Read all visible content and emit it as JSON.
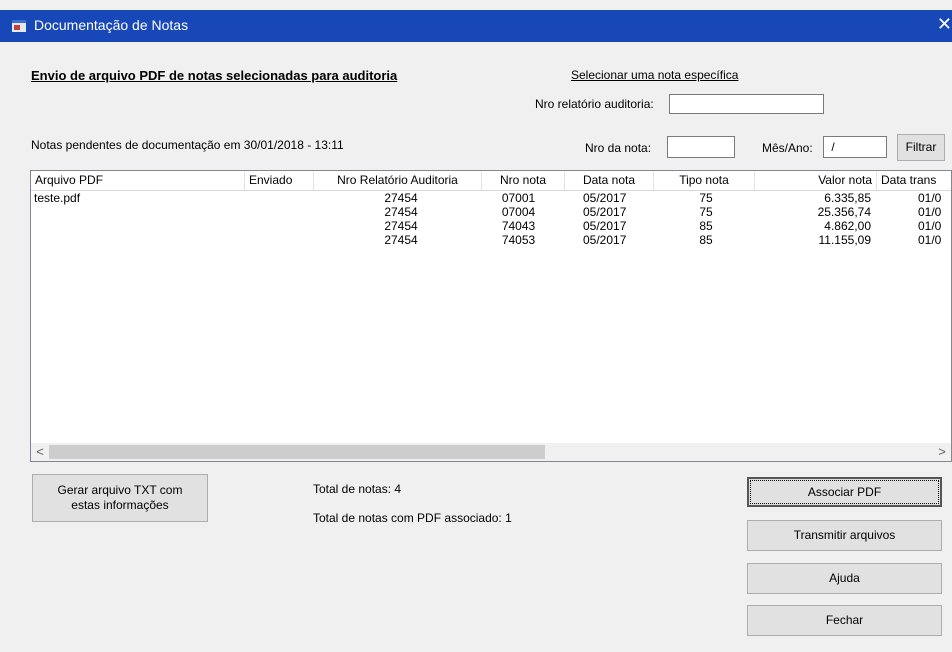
{
  "window": {
    "title": "Documentação de Notas",
    "close_glyph": "✕"
  },
  "header": {
    "heading": "Envio de arquivo PDF de notas selecionadas para auditoria",
    "select_link": "Selecionar uma nota específica",
    "nro_relatorio_label": "Nro relatório auditoria:",
    "nro_relatorio_value": "",
    "pending_label": "Notas pendentes de documentação em 30/01/2018 - 13:11",
    "nro_nota_label": "Nro da nota:",
    "nro_nota_value": "",
    "mes_ano_label": "Mês/Ano:",
    "mes_ano_value": " /",
    "filter_button": "Filtrar"
  },
  "table": {
    "columns": [
      "Arquivo PDF",
      "Enviado",
      "Nro Relatório Auditoria",
      "Nro nota",
      "Data nota",
      "Tipo nota",
      "Valor nota",
      "Data trans"
    ],
    "rows": [
      {
        "arquivo": "teste.pdf",
        "enviado": "",
        "relatorio": "27454",
        "nro": "07001",
        "data": "05/2017",
        "tipo": "75",
        "valor": "6.335,85",
        "trans": "01/0"
      },
      {
        "arquivo": "",
        "enviado": "",
        "relatorio": "27454",
        "nro": "07004",
        "data": "05/2017",
        "tipo": "75",
        "valor": "25.356,74",
        "trans": "01/0"
      },
      {
        "arquivo": "",
        "enviado": "",
        "relatorio": "27454",
        "nro": "74043",
        "data": "05/2017",
        "tipo": "85",
        "valor": "4.862,00",
        "trans": "01/0"
      },
      {
        "arquivo": "",
        "enviado": "",
        "relatorio": "27454",
        "nro": "74053",
        "data": "05/2017",
        "tipo": "85",
        "valor": "11.155,09",
        "trans": "01/0"
      }
    ],
    "scroll_left": "<",
    "scroll_right": ">"
  },
  "footer": {
    "gerar_button_line1": "Gerar arquivo TXT com",
    "gerar_button_line2": "estas informações",
    "total_notas": "Total de notas:  4",
    "total_pdf": "Total de notas com PDF associado:  1",
    "associar_button": "Associar PDF",
    "transmitir_button": "Transmitir arquivos",
    "ajuda_button": "Ajuda",
    "fechar_button": "Fechar"
  },
  "colors": {
    "titlebar": "#1848b8",
    "window_bg": "#f0f0f0",
    "accent_arc": "#16b8e0"
  }
}
